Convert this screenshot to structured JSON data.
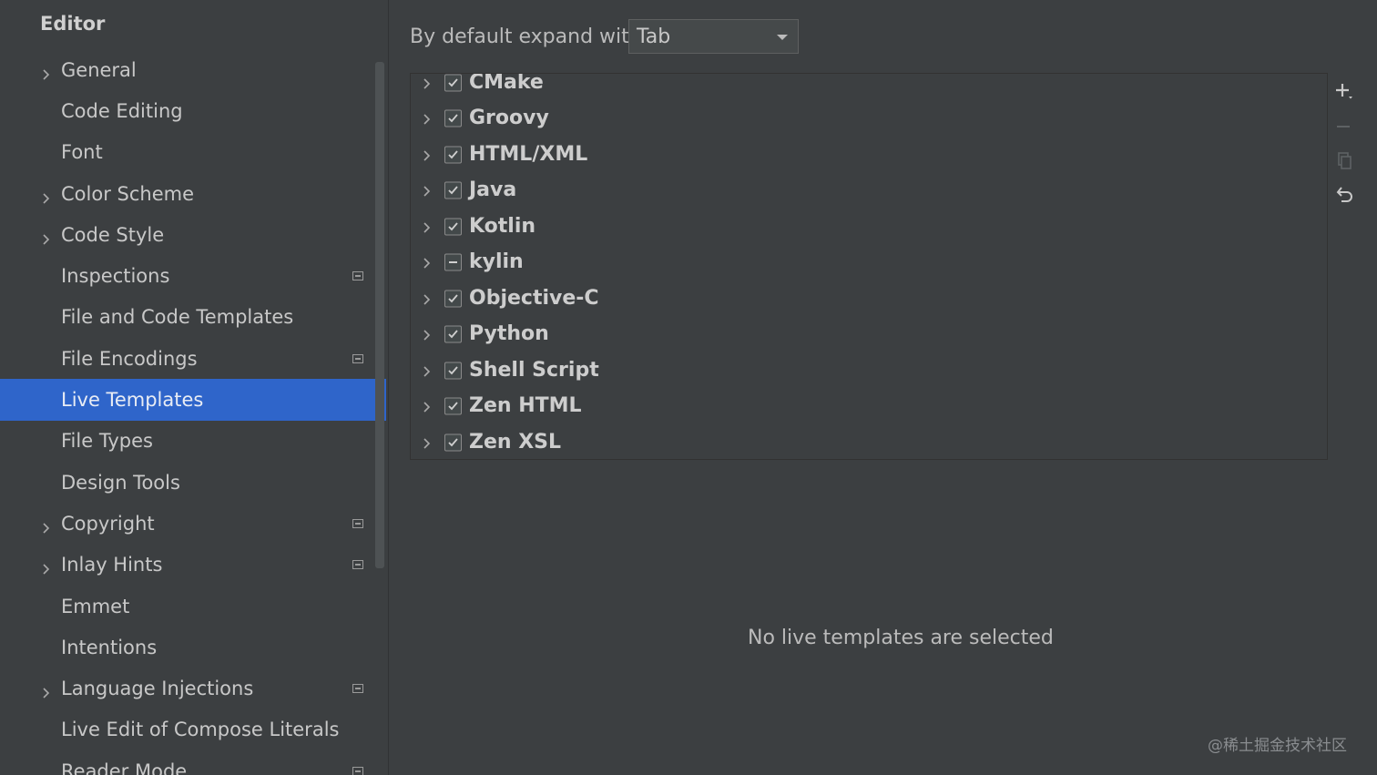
{
  "sidebar": {
    "section_title": "Editor",
    "items": [
      {
        "label": "General",
        "expandable": true,
        "project": false,
        "selected": false
      },
      {
        "label": "Code Editing",
        "expandable": false,
        "project": false,
        "selected": false
      },
      {
        "label": "Font",
        "expandable": false,
        "project": false,
        "selected": false
      },
      {
        "label": "Color Scheme",
        "expandable": true,
        "project": false,
        "selected": false
      },
      {
        "label": "Code Style",
        "expandable": true,
        "project": false,
        "selected": false
      },
      {
        "label": "Inspections",
        "expandable": false,
        "project": true,
        "selected": false
      },
      {
        "label": "File and Code Templates",
        "expandable": false,
        "project": false,
        "selected": false
      },
      {
        "label": "File Encodings",
        "expandable": false,
        "project": true,
        "selected": false
      },
      {
        "label": "Live Templates",
        "expandable": false,
        "project": false,
        "selected": true
      },
      {
        "label": "File Types",
        "expandable": false,
        "project": false,
        "selected": false
      },
      {
        "label": "Design Tools",
        "expandable": false,
        "project": false,
        "selected": false
      },
      {
        "label": "Copyright",
        "expandable": true,
        "project": true,
        "selected": false
      },
      {
        "label": "Inlay Hints",
        "expandable": true,
        "project": true,
        "selected": false
      },
      {
        "label": "Emmet",
        "expandable": false,
        "project": false,
        "selected": false
      },
      {
        "label": "Intentions",
        "expandable": false,
        "project": false,
        "selected": false
      },
      {
        "label": "Language Injections",
        "expandable": true,
        "project": true,
        "selected": false
      },
      {
        "label": "Live Edit of Compose Literals",
        "expandable": false,
        "project": false,
        "selected": false
      },
      {
        "label": "Reader Mode",
        "expandable": false,
        "project": true,
        "selected": false
      }
    ]
  },
  "main": {
    "expand_label": "By default expand with",
    "expand_value": "Tab",
    "template_groups": [
      {
        "name": "CMake",
        "state": "checked"
      },
      {
        "name": "Groovy",
        "state": "checked"
      },
      {
        "name": "HTML/XML",
        "state": "checked"
      },
      {
        "name": "Java",
        "state": "checked"
      },
      {
        "name": "Kotlin",
        "state": "checked"
      },
      {
        "name": "kylin",
        "state": "partial"
      },
      {
        "name": "Objective-C",
        "state": "checked"
      },
      {
        "name": "Python",
        "state": "checked"
      },
      {
        "name": "Shell Script",
        "state": "checked"
      },
      {
        "name": "Zen HTML",
        "state": "checked"
      },
      {
        "name": "Zen XSL",
        "state": "checked"
      }
    ],
    "toolbar": [
      "add-icon",
      "remove-icon",
      "copy-icon",
      "restore-icon"
    ],
    "empty_message": "No live templates are selected"
  },
  "watermark": "@稀土掘金技术社区",
  "colors": {
    "selection": "#2f65ca",
    "background": "#3c3f41",
    "text": "#bbbbbb"
  }
}
